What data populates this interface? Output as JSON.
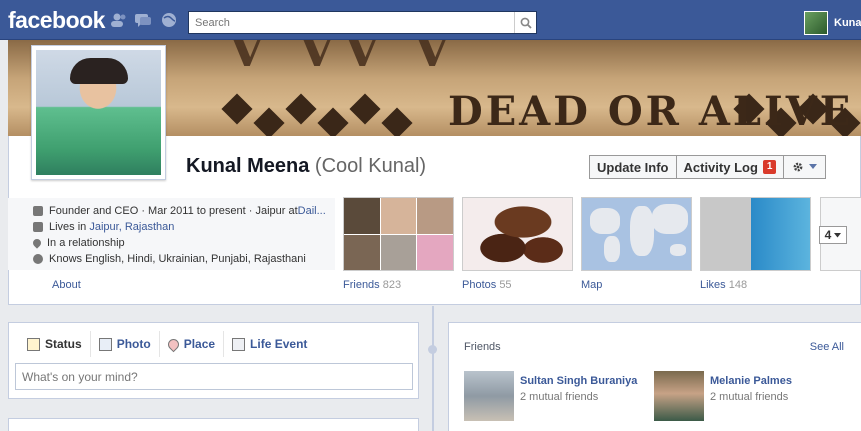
{
  "topbar": {
    "logo": "facebook",
    "search_placeholder": "Search",
    "user_name": "Kuna"
  },
  "profile": {
    "name": "Kunal Meena",
    "alt_name": "(Cool Kunal)",
    "cover_text": "DEAD OR ALIVE",
    "update_info": "Update Info",
    "activity_log": "Activity Log",
    "activity_count": "1"
  },
  "info": {
    "work_prefix": "Founder and CEO · Mar 2011 to present · Jaipur at ",
    "work_link": "Dail...",
    "lives_prefix": "Lives in ",
    "lives_link": "Jaipur, Rajasthan",
    "relationship": "In a relationship",
    "languages": "Knows English, Hindi, Ukrainian, Punjabi, Rajasthani",
    "about": "About"
  },
  "tiles": [
    {
      "label": "Friends",
      "count": "823"
    },
    {
      "label": "Photos",
      "count": "55"
    },
    {
      "label": "Map",
      "count": ""
    },
    {
      "label": "Likes",
      "count": "148"
    }
  ],
  "more_count": "4",
  "composer": {
    "tabs": [
      "Status",
      "Photo",
      "Place",
      "Life Event"
    ],
    "placeholder": "What's on your mind?"
  },
  "friends_box": {
    "title": "Friends",
    "see_all": "See All",
    "items": [
      {
        "name": "Sultan Singh Buraniya",
        "mutual": "2 mutual friends"
      },
      {
        "name": "Melanie Palmes",
        "mutual": "2 mutual friends"
      }
    ]
  },
  "colors": {
    "brand": "#3b5998",
    "badge": "#d93a2b"
  }
}
